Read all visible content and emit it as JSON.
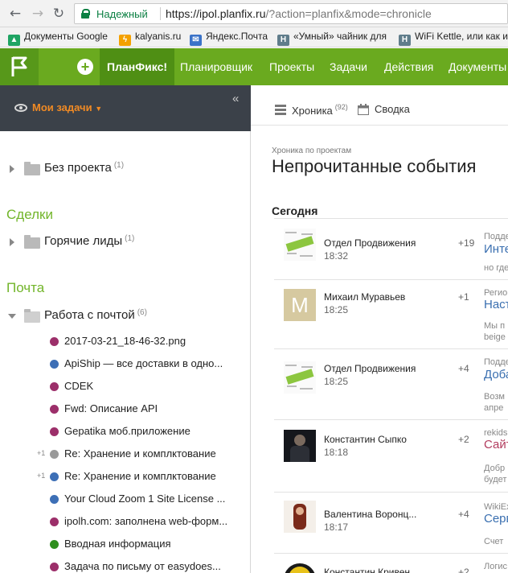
{
  "browser": {
    "security_label": "Надежный",
    "url_host": "https://ipol.planfix.ru",
    "url_path": "/?action=planfix&mode=chronicle",
    "bookmarks": [
      {
        "label": "Документы Google",
        "icon": "google-drive-icon",
        "color": "#1fa463"
      },
      {
        "label": "kalyanis.ru",
        "icon": "hookah-icon",
        "color": "#f4a100"
      },
      {
        "label": "Яндекс.Почта",
        "icon": "mail-icon",
        "color": "#3b73c8"
      },
      {
        "label": "«Умный» чайник для",
        "icon": "habr-icon",
        "color": "#607d8b"
      },
      {
        "label": "WiFi Kettle, или как и",
        "icon": "habr-icon",
        "color": "#607d8b"
      }
    ]
  },
  "nav": {
    "items": [
      "ПланФикс!",
      "Планировщик",
      "Проекты",
      "Задачи",
      "Действия",
      "Документы"
    ]
  },
  "sidebar": {
    "my_tasks": "Мои задачи",
    "folders": [
      {
        "label": "Без проекта",
        "count": "(1)"
      },
      {
        "label": "Горячие лиды",
        "count": "(1)"
      },
      {
        "label": "Работа с почтой",
        "count": "(6)"
      }
    ],
    "groups": [
      "Сделки",
      "Почта"
    ],
    "tasks": [
      {
        "label": "2017-03-21_18-46-32.png",
        "color": "#9c2f6a",
        "prefix": ""
      },
      {
        "label": "ApiShip — все доставки в одно...",
        "color": "#3d6fb6",
        "prefix": ""
      },
      {
        "label": "CDEK",
        "color": "#9c2f6a",
        "prefix": ""
      },
      {
        "label": "Fwd: Описание API",
        "color": "#9c2f6a",
        "prefix": ""
      },
      {
        "label": "Gepatika моб.приложение",
        "color": "#9c2f6a",
        "prefix": ""
      },
      {
        "label": "Re: Хранение и комплктование",
        "color": "#9a9a9a",
        "prefix": "+1"
      },
      {
        "label": "Re: Хранение и комплктование",
        "color": "#3d6fb6",
        "prefix": "+1"
      },
      {
        "label": "Your Cloud Zoom 1 Site License ...",
        "color": "#3d6fb6",
        "prefix": ""
      },
      {
        "label": "ipolh.com: заполнена web-форм...",
        "color": "#9c2f6a",
        "prefix": ""
      },
      {
        "label": "Вводная информация",
        "color": "#2f8f1e",
        "prefix": ""
      },
      {
        "label": "Задача по письму от easydoes...",
        "color": "#9c2f6a",
        "prefix": ""
      }
    ]
  },
  "main": {
    "tabs": [
      {
        "label": "Хроника",
        "count": "(92)"
      },
      {
        "label": "Сводка",
        "count": ""
      }
    ],
    "breadcrumb": "Хроника по проектам",
    "title": "Непрочитанные события",
    "today": "Сегодня",
    "events": [
      {
        "name": "Отдел Продвижения",
        "time": "18:32",
        "count": "+19",
        "category": "Подде",
        "title": "Инте",
        "text": "но где",
        "avatar": "seo",
        "title_color": "blue"
      },
      {
        "name": "Михаил Муравьев",
        "time": "18:25",
        "count": "+1",
        "category": "Регио",
        "title": "Наст",
        "text": "Мы п",
        "text2": "beige",
        "avatar": "M",
        "title_color": "blue"
      },
      {
        "name": "Отдел Продвижения",
        "time": "18:25",
        "count": "+4",
        "category": "Подде",
        "title": "Доба",
        "text": "Возм",
        "text2": "апре",
        "avatar": "seo",
        "title_color": "blue"
      },
      {
        "name": "Константин Сыпко",
        "time": "18:18",
        "count": "+2",
        "category": "rekids",
        "title": "Сайт",
        "text": "Добр",
        "text2": "будет",
        "avatar": "photo-dark",
        "title_color": "red"
      },
      {
        "name": "Валентина Воронц...",
        "time": "18:17",
        "count": "+4",
        "category": "WikiEx",
        "title": "Серв",
        "text": "Счет",
        "avatar": "photo-red",
        "title_color": "blue"
      },
      {
        "name": "Константин Кривен...",
        "time": "",
        "count": "+2",
        "category": "Логис",
        "title": "",
        "text": "",
        "avatar": "photo-yellow",
        "title_color": "blue"
      }
    ]
  }
}
